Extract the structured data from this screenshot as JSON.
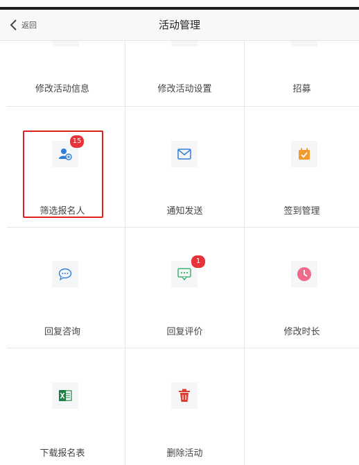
{
  "header": {
    "back_label": "返回",
    "title": "活动管理"
  },
  "grid": {
    "row1": [
      "修改活动信息",
      "修改活动设置",
      "招募"
    ],
    "row2": [
      "筛选报名人",
      "通知发送",
      "签到管理"
    ],
    "row3": [
      "回复咨询",
      "回复评价",
      "修改时长"
    ],
    "row4": [
      "下载报名表",
      "删除活动"
    ]
  },
  "badges": {
    "screen_applicants": "15",
    "reply_reviews": "1"
  },
  "icons": {
    "screen_applicants": "user-add-icon",
    "notify": "mail-icon",
    "checkin": "calendar-check-icon",
    "reply_consult": "chat-bubble-icon",
    "reply_review": "comment-dots-icon",
    "duration": "clock-icon",
    "download": "excel-icon",
    "delete": "trash-icon"
  },
  "colors": {
    "accent_blue": "#2f7fd8",
    "accent_orange": "#f29a2e",
    "accent_green": "#3cb371",
    "accent_pink": "#f06b8a",
    "accent_red": "#e03c31",
    "badge_red": "#e8333a",
    "highlight_red": "#e0201a"
  }
}
